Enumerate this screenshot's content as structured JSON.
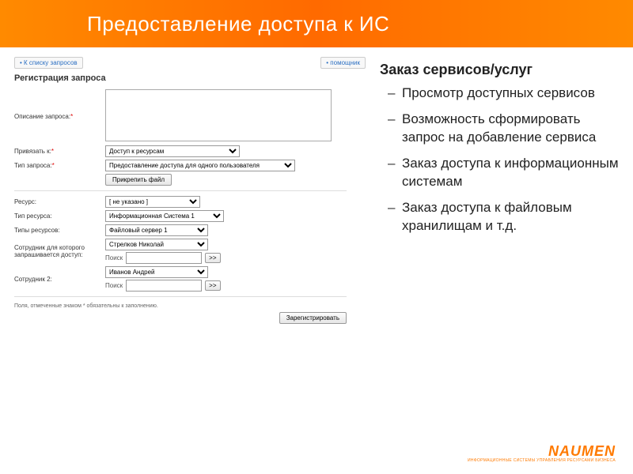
{
  "banner": {
    "title": "Предоставление доступа к ИС"
  },
  "nav": {
    "back": "К списку запросов",
    "help": "помощник"
  },
  "form": {
    "heading": "Регистрация запроса",
    "desc_label": "Описание запроса:",
    "attach_button": "Прикрепить файл",
    "register_button": "Зарегистрировать",
    "footnote": "Поля, отмеченные знаком * обязательны к заполнению.",
    "bind_to": {
      "label": "Привязать к:",
      "value": "Доступ к ресурсам"
    },
    "req_type": {
      "label": "Тип запроса:",
      "value": "Предоставление доступа для одного пользователя"
    },
    "resource": {
      "label": "Ресурс:",
      "value": "[ не указано ]"
    },
    "res_type": {
      "label": "Тип ресурса:",
      "value": "Информационная Система 1"
    },
    "res_types": {
      "label": "Типы ресурсов:",
      "value": "Файловый сервер 1"
    },
    "emp1": {
      "label": "Сотрудник для которого запрашивается доступ:",
      "value": "Стрелков Николай",
      "search": "Поиск"
    },
    "emp2": {
      "label": "Сотрудник 2:",
      "value": "Иванов Андрей",
      "search": "Поиск"
    },
    "go": ">>"
  },
  "right": {
    "title": "Заказ сервисов/услуг",
    "items": [
      "Просмотр доступных сервисов",
      "Возможность сформировать запрос на добавление сервиса",
      "Заказ доступа к информационным системам",
      "Заказ доступа к файловым хранилищам и т.д."
    ]
  },
  "logo": {
    "brand": "NAUMEN",
    "tag": "ИНФОРМАЦИОННЫЕ СИСТЕМЫ УПРАВЛЕНИЯ РЕСУРСАМИ БИЗНЕСА"
  }
}
